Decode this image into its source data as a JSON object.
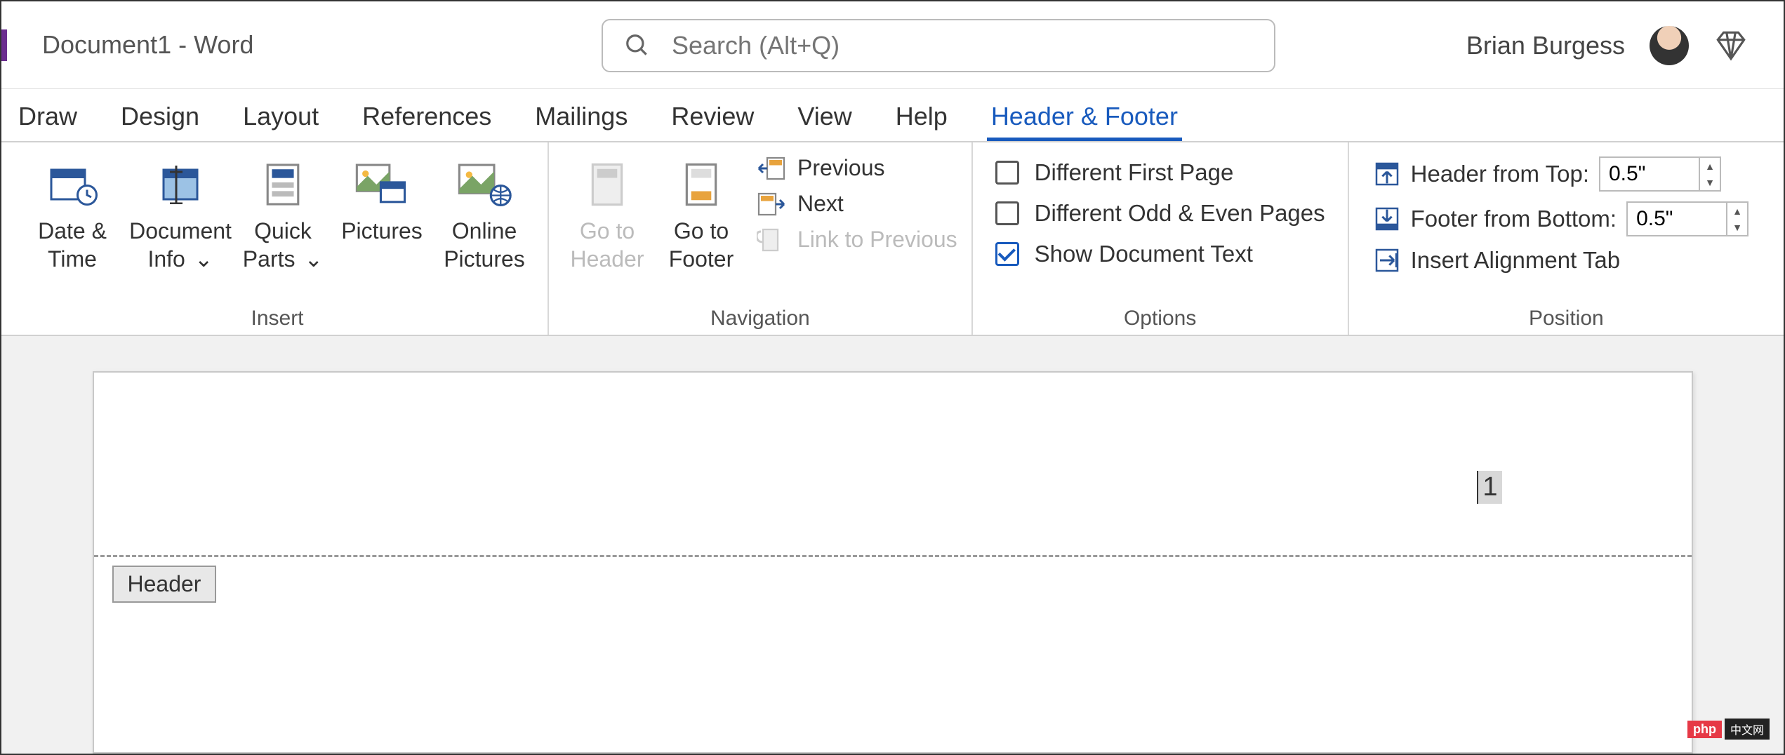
{
  "title": "Document1  -  Word",
  "search": {
    "placeholder": "Search (Alt+Q)"
  },
  "user": {
    "name": "Brian Burgess"
  },
  "tabs": [
    "Draw",
    "Design",
    "Layout",
    "References",
    "Mailings",
    "Review",
    "View",
    "Help",
    "Header & Footer"
  ],
  "active_tab": "Header & Footer",
  "ribbon": {
    "insert": {
      "label": "Insert",
      "buttons": {
        "date_time": "Date & Time",
        "doc_info": "Document Info",
        "quick_parts": "Quick Parts",
        "pictures": "Pictures",
        "online_pictures": "Online Pictures"
      }
    },
    "navigation": {
      "label": "Navigation",
      "go_header": "Go to Header",
      "go_footer": "Go to Footer",
      "previous": "Previous",
      "next": "Next",
      "link_prev": "Link to Previous"
    },
    "options": {
      "label": "Options",
      "diff_first": "Different First Page",
      "diff_odd_even": "Different Odd & Even Pages",
      "show_doc_text": "Show Document Text",
      "checked": {
        "diff_first": false,
        "diff_odd_even": false,
        "show_doc_text": true
      }
    },
    "position": {
      "label": "Position",
      "header_top": "Header from Top:",
      "footer_bottom": "Footer from Bottom:",
      "align_tab": "Insert Alignment Tab",
      "header_val": "0.5\"",
      "footer_val": "0.5\""
    }
  },
  "document": {
    "page_number": "1",
    "header_tag": "Header"
  },
  "watermark": {
    "left": "php",
    "right": "中文网"
  }
}
